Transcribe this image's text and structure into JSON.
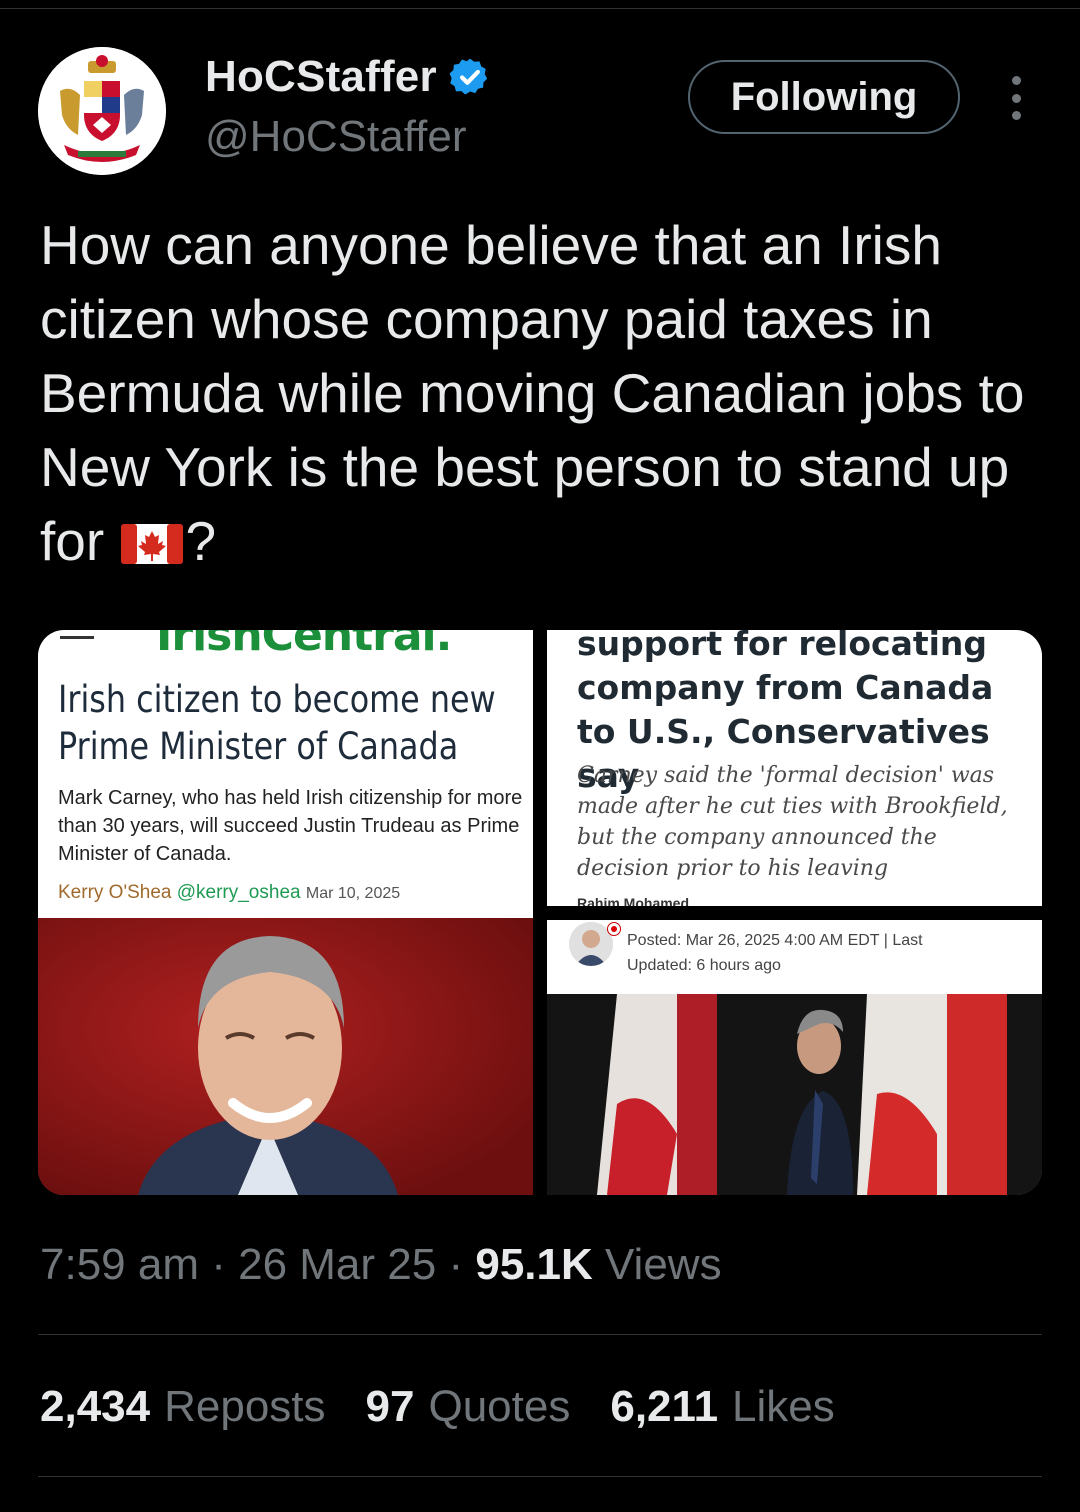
{
  "account": {
    "display_name": "HoCStaffer",
    "handle": "@HoCStaffer",
    "avatar_icon": "canada-coat-of-arms-icon",
    "verified_icon": "verified-badge-icon",
    "verified_color": "#1d9bf0"
  },
  "actions": {
    "follow_label": "Following",
    "more_icon": "more-options-icon"
  },
  "tweet": {
    "text_before_flag": "How can anyone believe that an Irish citizen whose company paid taxes in Bermuda while moving Canadian jobs to New York is the best person to stand up for ",
    "flag_icon": "canada-flag-emoji",
    "text_after_flag": "?"
  },
  "media": {
    "left_card": {
      "logo_text": "IrishCentral.",
      "headline_line1": "Irish citizen to become new",
      "headline_line2": "Prime Minister of Canada",
      "subtext": "Mark Carney, who has held Irish citizenship for more than 30 years, will succeed Justin Trudeau as Prime Minister of Canada.",
      "author": "Kerry O'Shea",
      "author_handle": "@kerry_oshea",
      "date": "Mar 10, 2025"
    },
    "right_top_card": {
      "headline": "support for relocating company from Canada to U.S., Conservatives say",
      "subtext": "Carney said the 'formal decision' was made after he cut ties with Brookfield, but the company announced the decision prior to his leaving",
      "author": "Rahim Mohamed"
    },
    "right_bottom_card": {
      "posted_line1": "Posted: Mar 26, 2025 4:00 AM EDT | Last",
      "posted_line2": "Updated: 6 hours ago"
    }
  },
  "meta": {
    "time": "7:59 am",
    "date": "26 Mar 25",
    "views_count": "95.1K",
    "views_label": "Views",
    "separator": "·"
  },
  "stats": {
    "reposts_count": "2,434",
    "reposts_label": "Reposts",
    "quotes_count": "97",
    "quotes_label": "Quotes",
    "likes_count": "6,211",
    "likes_label": "Likes"
  }
}
